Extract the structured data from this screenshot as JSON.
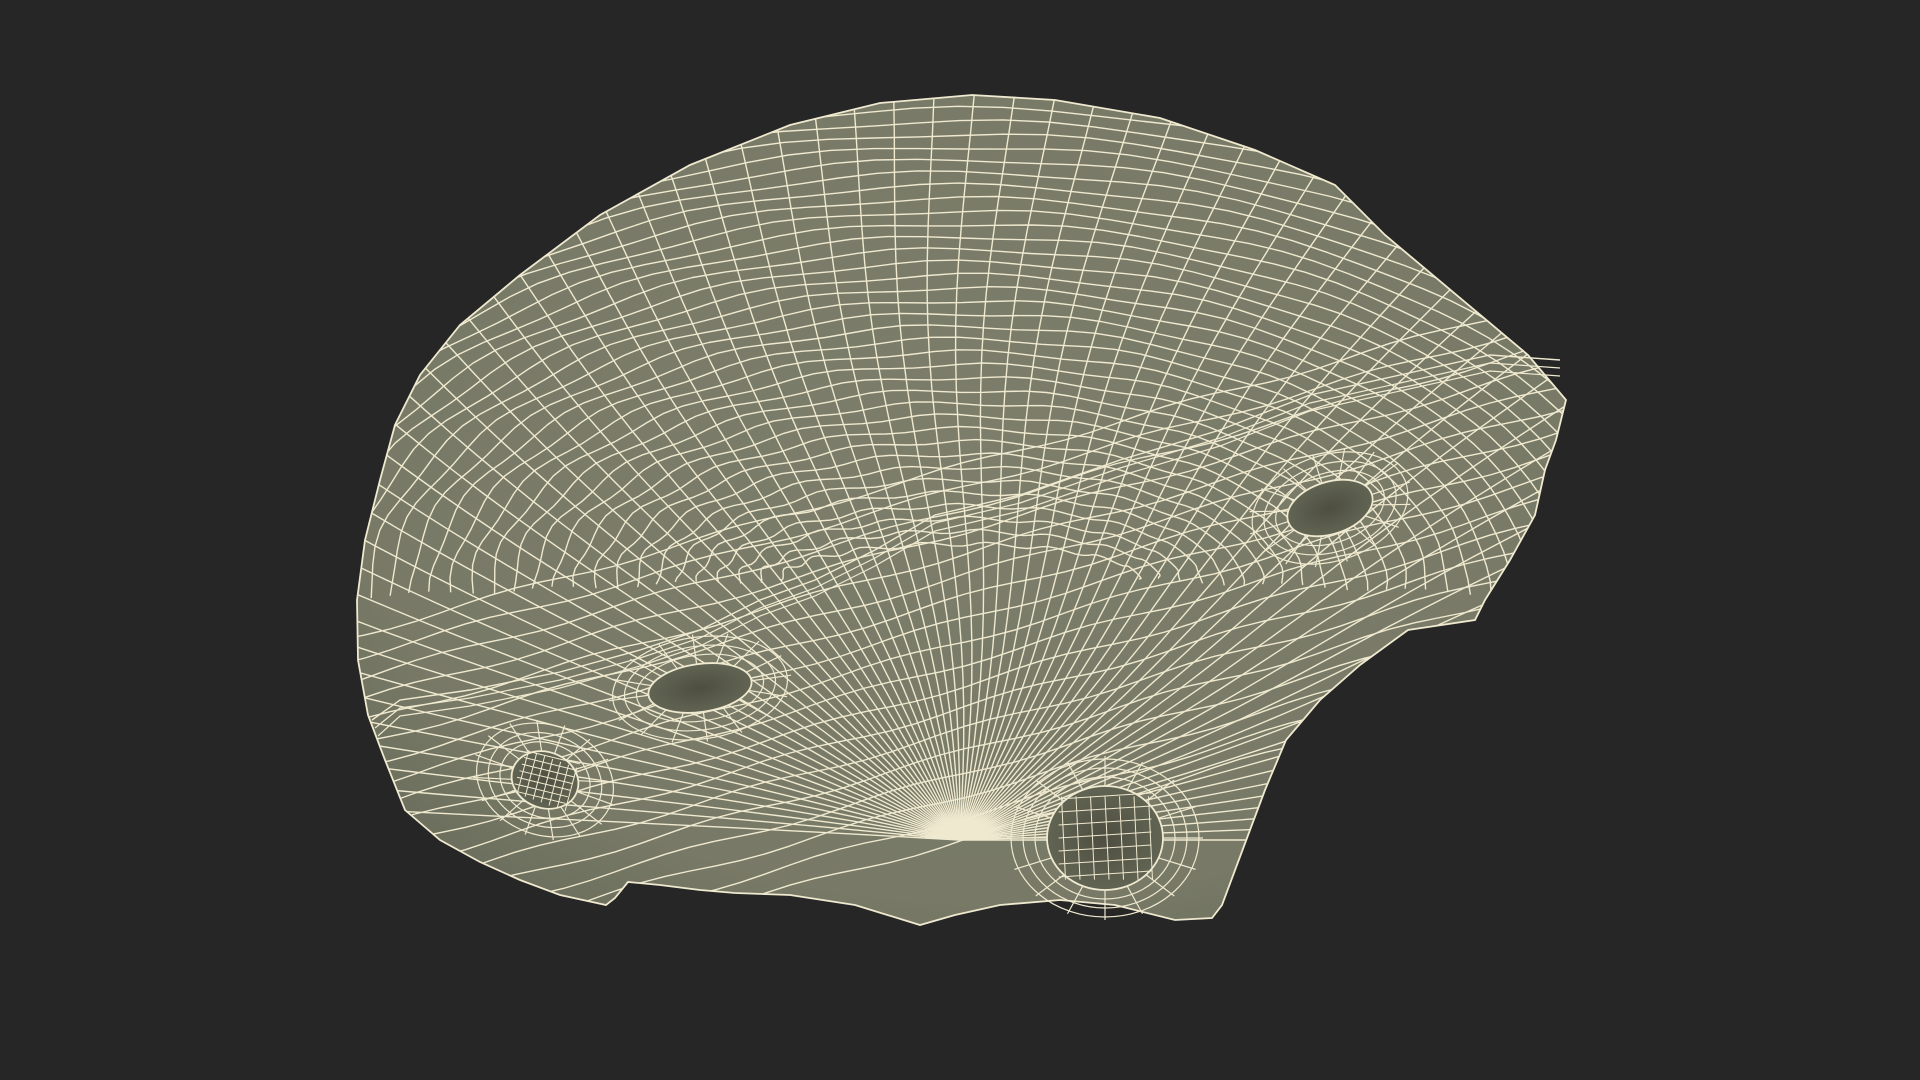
{
  "scene": {
    "subject": "climbing-hold-wireframe-mesh",
    "colors": {
      "background": "#262626",
      "surface": "#7a7c69",
      "surface_shadow": "#6f7160",
      "hole_fill": "#5a5b4c",
      "wire": "#efe9cf"
    },
    "bolt_holes": 4
  }
}
